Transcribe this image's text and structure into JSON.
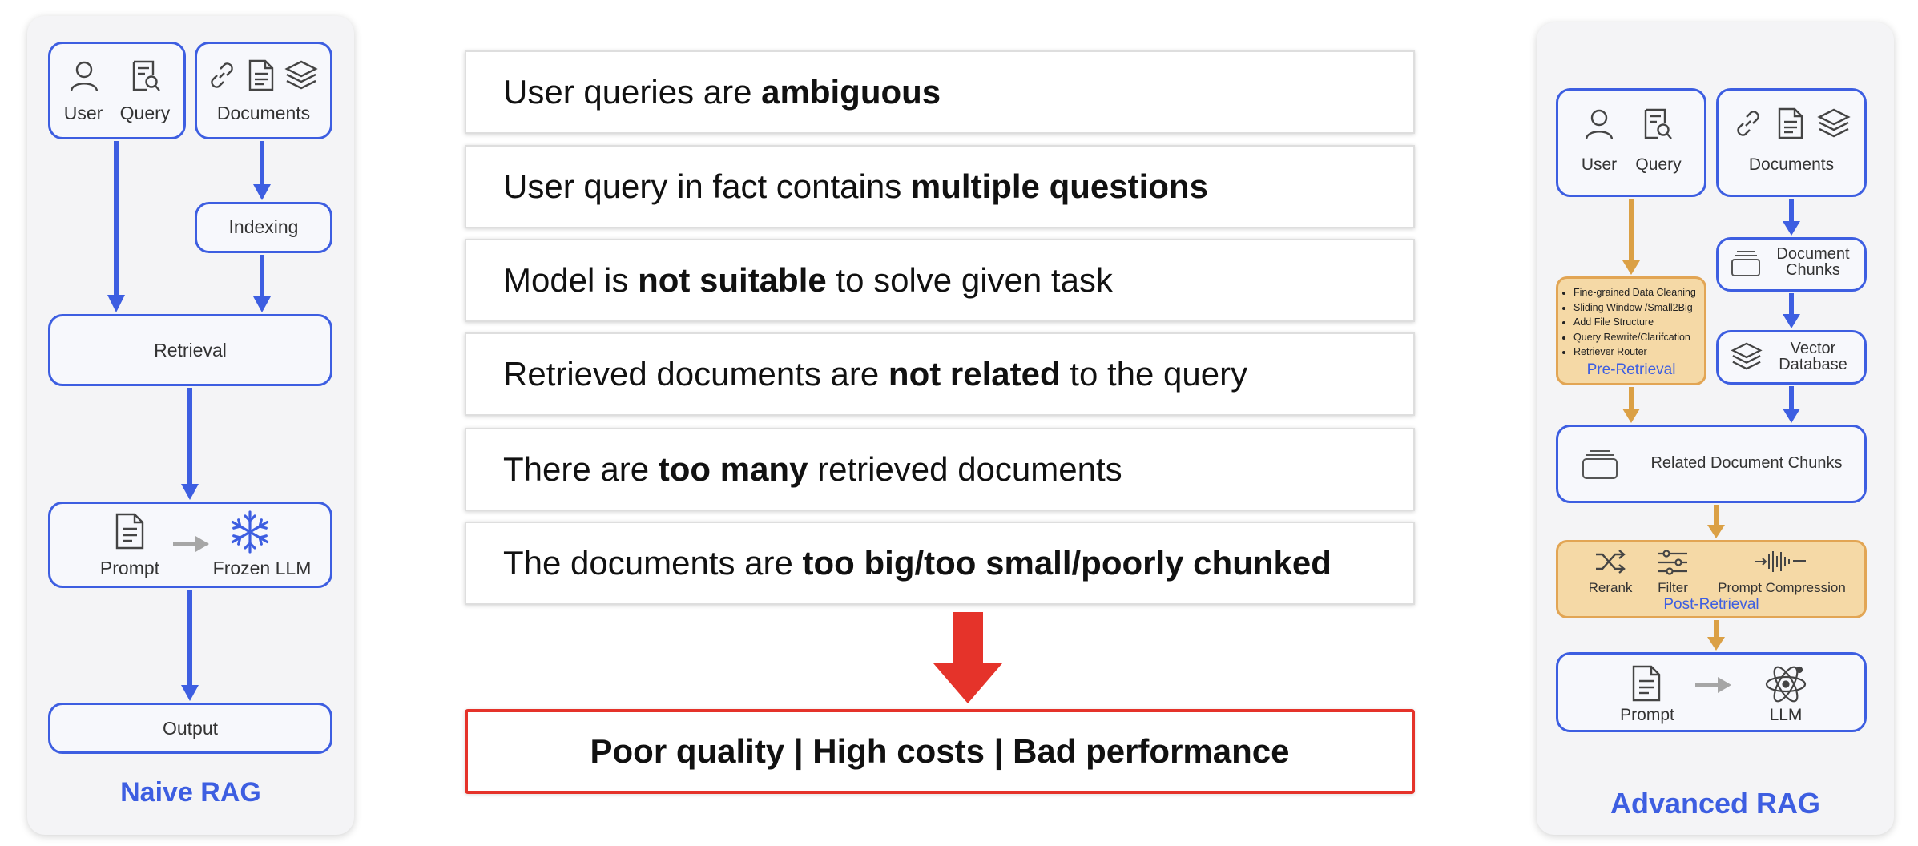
{
  "colors": {
    "accent_blue": "#3d5ee1",
    "arrow_orange": "#dba045",
    "panel_bg": "#f4f4f6",
    "problem_red": "#e5332a",
    "gray_arrow": "#a6a6a6"
  },
  "naive": {
    "title": "Naive RAG",
    "user": "User",
    "query": "Query",
    "documents": "Documents",
    "indexing": "Indexing",
    "retrieval": "Retrieval",
    "prompt": "Prompt",
    "frozen_llm": "Frozen LLM",
    "output": "Output"
  },
  "problems": {
    "items": [
      {
        "pre": "User queries are ",
        "bold": "ambiguous",
        "post": ""
      },
      {
        "pre": "User query in fact contains ",
        "bold": "multiple questions",
        "post": ""
      },
      {
        "pre": "Model is ",
        "bold": "not suitable",
        "post": " to solve given task"
      },
      {
        "pre": "Retrieved documents are ",
        "bold": "not related",
        "post": " to the query"
      },
      {
        "pre": "There are ",
        "bold": "too many",
        "post": " retrieved documents"
      },
      {
        "pre": "The documents are ",
        "bold": "too big/too small/poorly chunked",
        "post": ""
      }
    ],
    "result": "Poor quality | High costs | Bad performance"
  },
  "advanced": {
    "title": "Advanced RAG",
    "user": "User",
    "query": "Query",
    "documents": "Documents",
    "document_chunks": [
      "Document",
      "Chunks"
    ],
    "vector_database": [
      "Vector",
      "Database"
    ],
    "pre_retrieval_items": [
      "Fine-grained Data Cleaning",
      "Sliding Window /Small2Big",
      "Add File Structure",
      "Query Rewrite/Clarifcation",
      "Retriever Router"
    ],
    "pre_retrieval": "Pre-Retrieval",
    "related_chunks": "Related Document Chunks",
    "rerank": "Rerank",
    "filter": "Filter",
    "prompt_compression": "Prompt Compression",
    "post_retrieval": "Post-Retrieval",
    "prompt": "Prompt",
    "llm": "LLM"
  },
  "icons": [
    "person-icon",
    "magnifier-document-icon",
    "link-icon",
    "document-icon",
    "layers-icon",
    "snowflake-icon",
    "chunks-icon",
    "shuffle-icon",
    "sliders-icon",
    "waveform-icon",
    "atom-icon",
    "arrow-down-icon"
  ]
}
